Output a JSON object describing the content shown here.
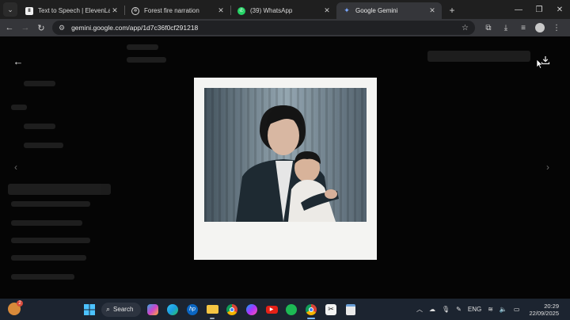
{
  "browser": {
    "tabs": [
      {
        "title": "Text to Speech | ElevenLabs",
        "icon": "elevenlabs-icon",
        "active": false
      },
      {
        "title": "Forest fire narration",
        "icon": "openai-icon",
        "active": false
      },
      {
        "title": "(39) WhatsApp",
        "icon": "whatsapp-icon",
        "active": false
      },
      {
        "title": "Google Gemini",
        "icon": "gemini-icon",
        "active": true
      }
    ],
    "url": "gemini.google.com/app/1d7c36f0cf291218"
  },
  "taskbar": {
    "search_label": "Search",
    "language": "ENG",
    "time": "20:29",
    "date": "22/09/2025",
    "notification_count": "2"
  },
  "colors": {
    "tab_bar": "#1f1f1f",
    "toolbar": "#35363a",
    "omnibox": "#202124",
    "viewer_backdrop": "#050505",
    "polaroid_frame": "#f4f4f2",
    "taskbar": "#1c2430"
  }
}
